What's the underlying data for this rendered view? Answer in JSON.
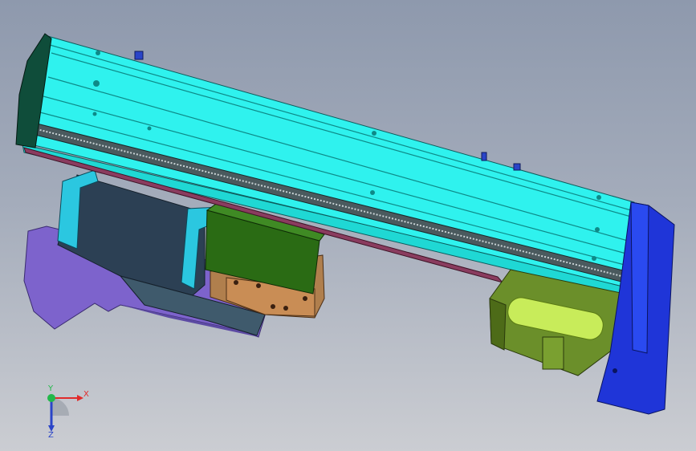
{
  "viewport": {
    "background_top": "#8e99ad",
    "background_bottom": "#cbcdd2"
  },
  "model": {
    "colors": {
      "beam_top": "#2ff2ee",
      "beam_face": "#1fd8d4",
      "beam_end": "#0f4d3a",
      "belt": "#4a5a5e",
      "support_plate": "#2c4054",
      "support_rib": "#2bc7e0",
      "slider_block": "#2a6b14",
      "carriage_brown": "#b07f4d",
      "purple_bracket": "#7d63cc",
      "motor_housing": "#6b8f2a",
      "motor_shaft": "#c8ec5a",
      "end_plate": "#1f35d8",
      "rail_pink": "#8a3c5f"
    }
  },
  "triad": {
    "x_label": "X",
    "y_label": "Y",
    "z_label": "Z",
    "x_color": "#e12b2b",
    "y_color": "#22b84a",
    "z_color": "#2a44c8"
  }
}
